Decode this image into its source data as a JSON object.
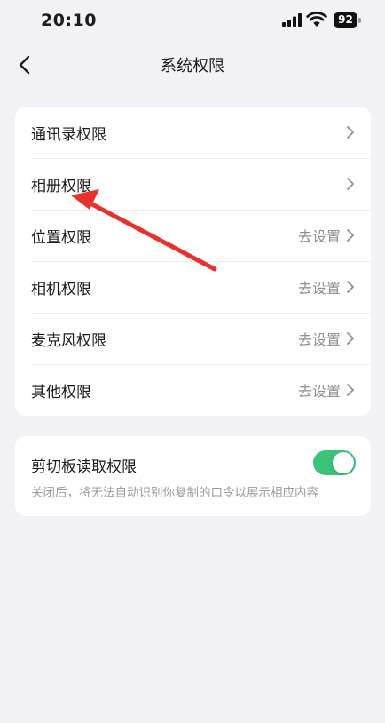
{
  "status_bar": {
    "time": "20:10",
    "battery": "92",
    "icons": [
      "signal-icon",
      "wifi-icon",
      "battery-icon"
    ]
  },
  "header": {
    "title": "系统权限",
    "back_icon": "chevron-left-icon"
  },
  "permissions": {
    "items": [
      {
        "label": "通讯录权限",
        "action": ""
      },
      {
        "label": "相册权限",
        "action": ""
      },
      {
        "label": "位置权限",
        "action": "去设置"
      },
      {
        "label": "相机权限",
        "action": "去设置"
      },
      {
        "label": "麦克风权限",
        "action": "去设置"
      },
      {
        "label": "其他权限",
        "action": "去设置"
      }
    ]
  },
  "clipboard": {
    "title": "剪切板读取权限",
    "description": "关闭后，将无法自动识别你复制的口令以展示相应内容",
    "enabled": true
  },
  "colors": {
    "background": "#f2f2f6",
    "toggle_on": "#3bc37a",
    "annotation_arrow": "#e8302c",
    "secondary_text": "#8e8e93"
  }
}
